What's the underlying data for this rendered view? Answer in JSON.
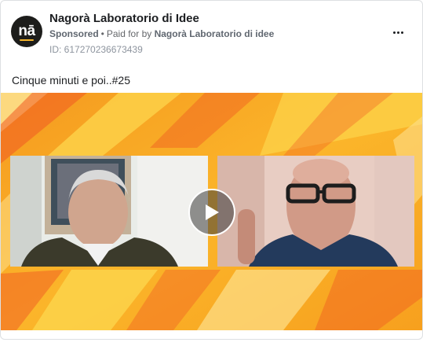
{
  "post": {
    "page_name": "Nagorà Laboratorio di Idee",
    "avatar_text": "nā",
    "sponsored_label": "Sponsored",
    "paid_for_prefix": "Paid for by",
    "paid_for_name": "Nagorà Laboratorio di idee",
    "ad_id": "ID: 617270236673439",
    "caption": "Cinque minuti e poi..#25",
    "more_icon": "more-horizontal-icon"
  },
  "video": {
    "play_icon": "play-icon",
    "background_colors": [
      "#f7a623",
      "#fcd34a",
      "#f05a22",
      "#fde08a"
    ]
  }
}
